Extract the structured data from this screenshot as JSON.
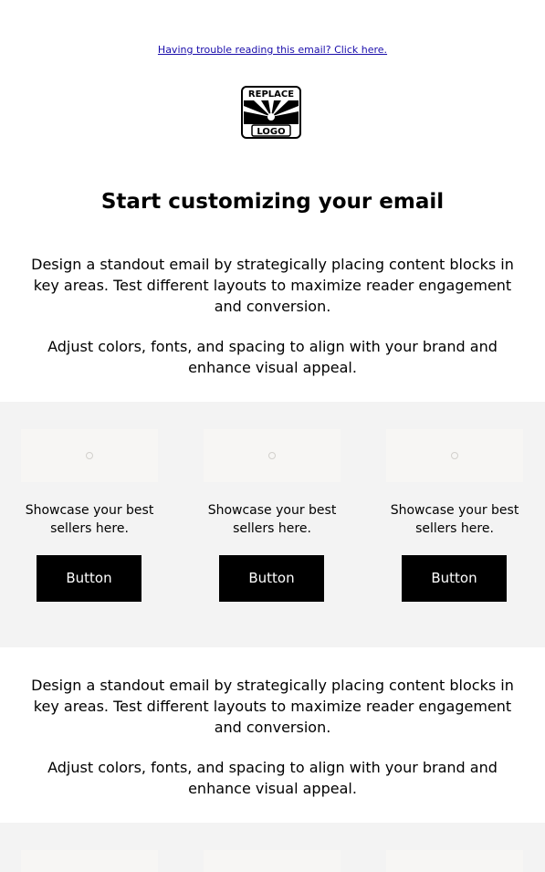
{
  "preheader": {
    "link_text": "Having trouble reading this email? Click here."
  },
  "logo": {
    "line1": "REPLACE",
    "line2": "LOGO"
  },
  "header": {
    "title": "Start customizing your email"
  },
  "text_block_1": {
    "p1": "Design a standout email by strategically placing content blocks in key areas. Test different layouts to maximize reader engagement and conversion.",
    "p2": "Adjust colors, fonts, and spacing to align with your brand and enhance visual appeal."
  },
  "products": [
    {
      "caption": "Showcase your best sellers here.",
      "button_label": "Button"
    },
    {
      "caption": "Showcase your best sellers here.",
      "button_label": "Button"
    },
    {
      "caption": "Showcase your best sellers here.",
      "button_label": "Button"
    }
  ],
  "text_block_2": {
    "p1": "Design a standout email by strategically placing content blocks in key areas. Test different layouts to maximize reader engagement and conversion.",
    "p2": "Adjust colors, fonts, and spacing to align with your brand and enhance visual appeal."
  },
  "colors": {
    "section_background": "#f3f3f3",
    "button_background": "#000000",
    "button_text": "#ffffff",
    "link": "#1a0dab"
  },
  "icons": {
    "image_placeholder": "image-placeholder-icon"
  }
}
